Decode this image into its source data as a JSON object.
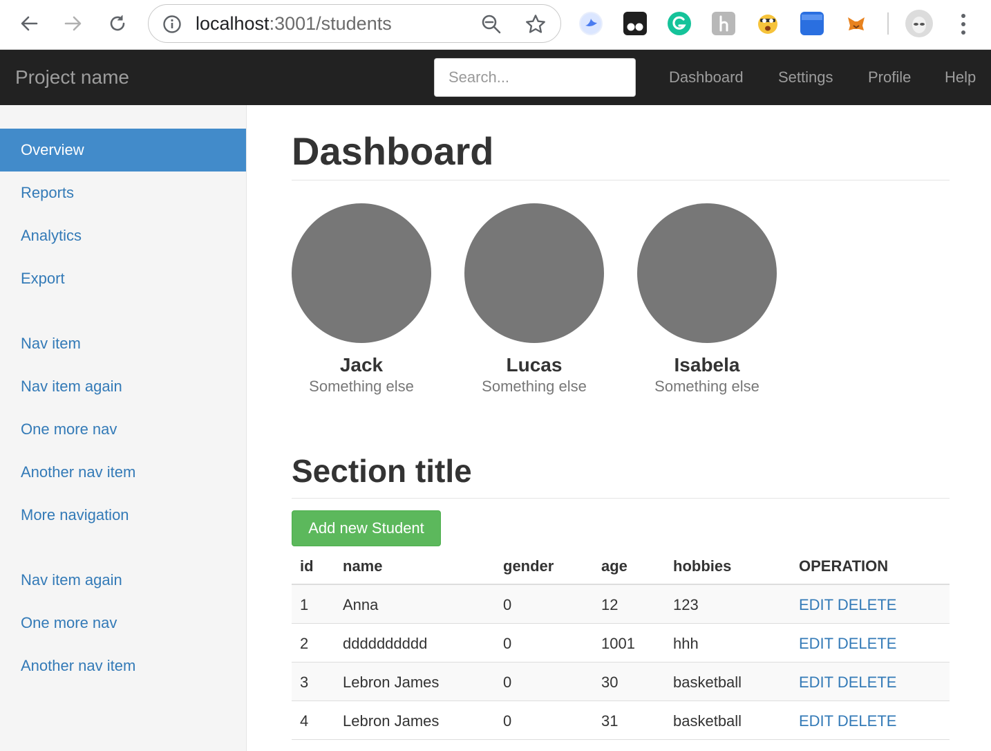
{
  "browser": {
    "url_host": "localhost",
    "url_rest": ":3001/students"
  },
  "navbar": {
    "brand": "Project name",
    "search_placeholder": "Search...",
    "links": [
      "Dashboard",
      "Settings",
      "Profile",
      "Help"
    ]
  },
  "sidebar": {
    "items": [
      "Overview",
      "Reports",
      "Analytics",
      "Export",
      "Nav item",
      "Nav item again",
      "One more nav",
      "Another nav item",
      "More navigation",
      "Nav item again",
      "One more nav",
      "Another nav item"
    ],
    "active": "Overview"
  },
  "main": {
    "title": "Dashboard",
    "people": [
      {
        "name": "Jack",
        "subtitle": "Something else"
      },
      {
        "name": "Lucas",
        "subtitle": "Something else"
      },
      {
        "name": "Isabela",
        "subtitle": "Something else"
      }
    ],
    "section_title": "Section title",
    "add_button": "Add new Student",
    "table": {
      "headers": [
        "id",
        "name",
        "gender",
        "age",
        "hobbies",
        "OPERATION"
      ],
      "rows": [
        {
          "id": "1",
          "name": "Anna",
          "gender": "0",
          "age": "12",
          "hobbies": "123"
        },
        {
          "id": "2",
          "name": "dddddddddd",
          "gender": "0",
          "age": "1001",
          "hobbies": "hhh"
        },
        {
          "id": "3",
          "name": "Lebron James",
          "gender": "0",
          "age": "30",
          "hobbies": "basketball"
        },
        {
          "id": "4",
          "name": "Lebron James",
          "gender": "0",
          "age": "31",
          "hobbies": "basketball"
        }
      ],
      "edit_label": "EDIT",
      "delete_label": "DELETE"
    }
  },
  "colors": {
    "navbar_bg": "#222222",
    "active_nav": "#428bca",
    "link": "#337ab7",
    "success": "#5cb85c",
    "avatar": "#777777"
  }
}
